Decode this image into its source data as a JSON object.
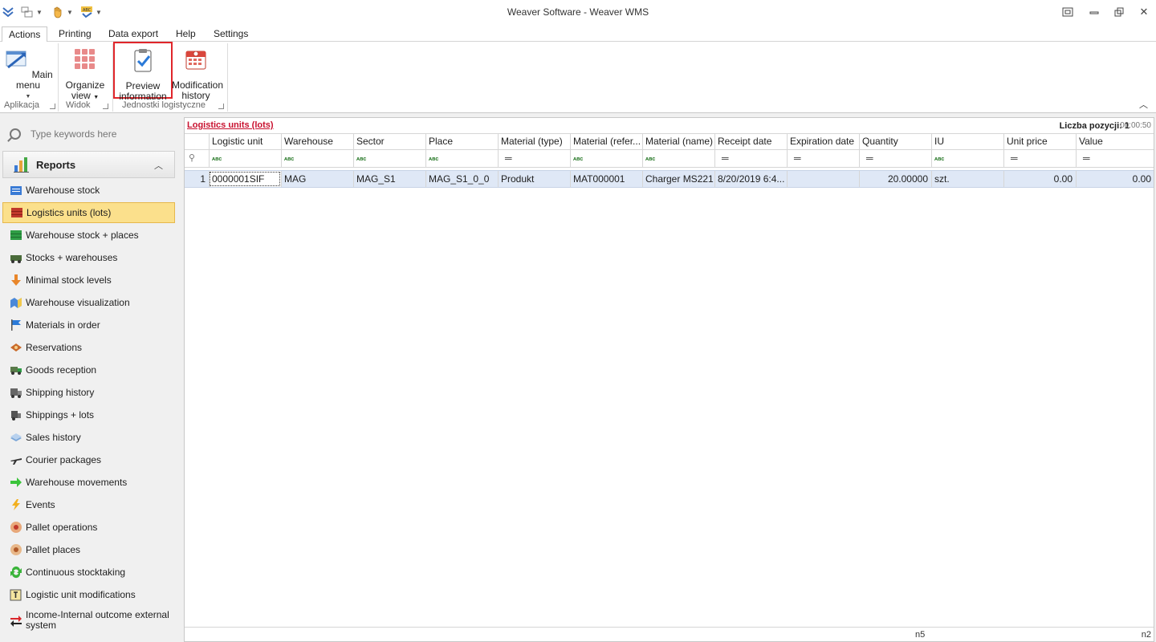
{
  "window": {
    "title": "Weaver Software - Weaver WMS"
  },
  "tabs": [
    {
      "label": "Actions",
      "active": true
    },
    {
      "label": "Printing"
    },
    {
      "label": "Data export"
    },
    {
      "label": "Help"
    },
    {
      "label": "Settings"
    }
  ],
  "ribbon": {
    "groups": [
      {
        "label": "Aplikacja"
      },
      {
        "label": "Widok"
      },
      {
        "label": "Jednostki logistyczne"
      }
    ],
    "buttons": {
      "main_menu": "Main menu",
      "organize_view_1": "Organize",
      "organize_view_2": "view",
      "preview_1": "Preview",
      "preview_2": "information",
      "modification_1": "Modification",
      "modification_2": "history"
    }
  },
  "search": {
    "placeholder": "Type keywords here"
  },
  "reports": {
    "header": "Reports",
    "items": [
      {
        "label": "Warehouse stock",
        "icon": "warehouse-stock-icon"
      },
      {
        "label": "Logistics units (lots)",
        "icon": "logistics-units-icon",
        "selected": true
      },
      {
        "label": "Warehouse stock + places",
        "icon": "stock-places-icon"
      },
      {
        "label": "Stocks + warehouses",
        "icon": "stocks-warehouses-icon"
      },
      {
        "label": "Minimal stock levels",
        "icon": "minimal-stock-icon"
      },
      {
        "label": "Warehouse visualization",
        "icon": "visualization-icon"
      },
      {
        "label": "Materials in order",
        "icon": "flag-icon"
      },
      {
        "label": "Reservations",
        "icon": "reservations-icon"
      },
      {
        "label": "Goods reception",
        "icon": "truck-icon"
      },
      {
        "label": "Shipping history",
        "icon": "shipping-history-icon"
      },
      {
        "label": "Shippings + lots",
        "icon": "shippings-lots-icon"
      },
      {
        "label": "Sales history",
        "icon": "sales-history-icon"
      },
      {
        "label": "Courier packages",
        "icon": "plane-icon"
      },
      {
        "label": "Warehouse movements",
        "icon": "green-arrow-icon"
      },
      {
        "label": "Events",
        "icon": "lightning-icon"
      },
      {
        "label": "Pallet operations",
        "icon": "pallet-operations-icon"
      },
      {
        "label": "Pallet places",
        "icon": "pallet-places-icon"
      },
      {
        "label": "Continuous stocktaking",
        "icon": "refresh-icon"
      },
      {
        "label": "Logistic unit modifications",
        "icon": "modifications-icon"
      },
      {
        "label": "Income-Internal outcome external system",
        "icon": "exchange-icon"
      }
    ]
  },
  "grid": {
    "title": "Logistics units (lots)",
    "count_label": "Liczba pozycji: 1",
    "time": "00:00:50",
    "columns": [
      "Logistic unit",
      "Warehouse",
      "Sector",
      "Place",
      "Material (type)",
      "Material (refer...",
      "Material (name)",
      "Receipt date",
      "Expiration date",
      "Quantity",
      "IU",
      "Unit price",
      "Value"
    ],
    "filters": [
      "abc",
      "abc",
      "abc",
      "abc",
      "=",
      "abc",
      "abc",
      "=",
      "=",
      "=",
      "abc",
      "=",
      "="
    ],
    "rows": [
      {
        "num": "1",
        "cells": [
          "0000001SIF",
          "MAG",
          "MAG_S1",
          "MAG_S1_0_0",
          "Produkt",
          "MAT000001",
          "Charger MS221",
          "8/20/2019 6:4...",
          "",
          "20.00000",
          "szt.",
          "0.00",
          "0.00"
        ]
      }
    ],
    "footer": {
      "left": "n5",
      "right": "n2"
    }
  }
}
